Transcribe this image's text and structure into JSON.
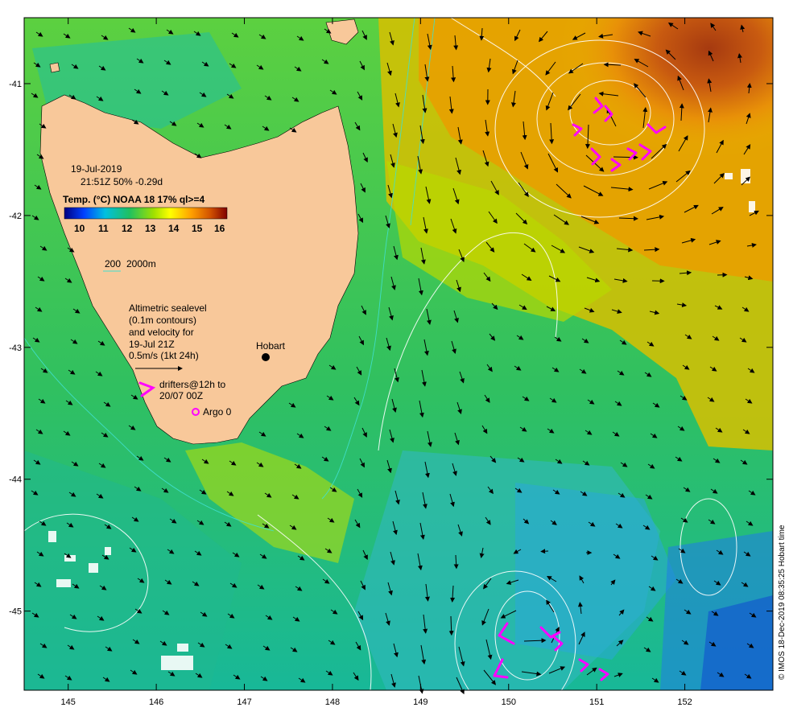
{
  "map": {
    "date": "19-Jul-2019",
    "time_line": "21:51Z  50% -0.29d",
    "colorbar_title": "Temp. (°C) NOAA 18 17% ql>=4",
    "colorbar_ticks": [
      "10",
      "11",
      "12",
      "13",
      "14",
      "15",
      "16"
    ],
    "colorbar_range": [
      9.5,
      16.5
    ],
    "bathy_legend": {
      "label_200": "200",
      "label_2000": "2000m"
    },
    "sealevel_text": [
      "Altimetric sealevel",
      "(0.1m contours)",
      "and velocity for",
      "19-Jul 21Z",
      "0.5m/s (1kt 24h)"
    ],
    "drifters_text": [
      "drifters@12h to",
      "20/07 00Z"
    ],
    "argo_text": "Argo 0",
    "city_label": "Hobart",
    "lon_ticks": [
      "145",
      "146",
      "147",
      "148",
      "149",
      "150",
      "151",
      "152"
    ],
    "lat_ticks": [
      "-41",
      "-42",
      "-43",
      "-44",
      "-45"
    ],
    "credit": "© IMOS 18-Dec-2019 08:35:25 Hobart time",
    "extent": {
      "lon": [
        144.5,
        153.0
      ],
      "lat": [
        -45.6,
        -40.5
      ]
    },
    "colors": {
      "land": "#f8c89a",
      "drifter": "#ff00ff",
      "argo": "#ff00ff",
      "contour": "#ffffff",
      "bathy": "#40e0d0",
      "arrow": "#000000"
    }
  }
}
